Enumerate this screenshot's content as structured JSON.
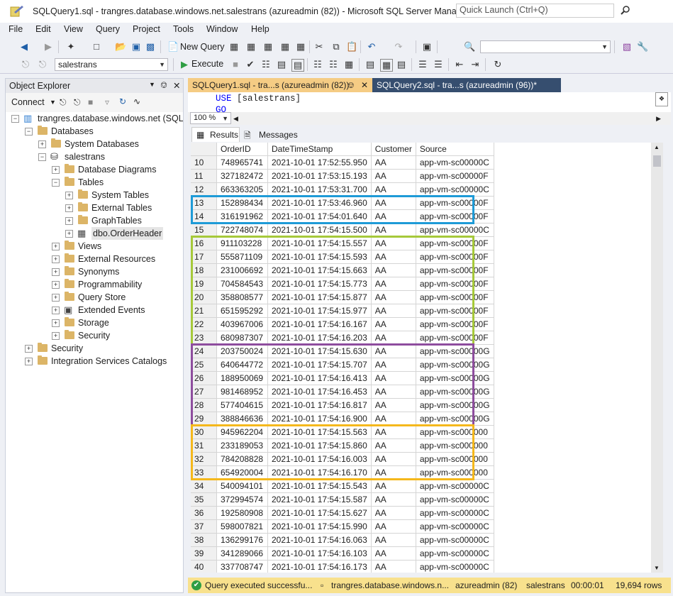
{
  "window": {
    "title": "SQLQuery1.sql - trangres.database.windows.net.salestrans (azureadmin (82)) - Microsoft SQL Server Manageme...",
    "quick_launch_placeholder": "Quick Launch (Ctrl+Q)"
  },
  "menu": [
    "File",
    "Edit",
    "View",
    "Query",
    "Project",
    "Tools",
    "Window",
    "Help"
  ],
  "toolbar": {
    "new_query_label": "New Query",
    "database_selector": "salestrans",
    "execute_label": "Execute",
    "icons": [
      "back-icon",
      "forward-icon",
      "new-project-icon",
      "open-file-icon",
      "save-icon",
      "save-all-icon",
      "cut-icon",
      "copy-icon",
      "paste-icon",
      "undo-icon",
      "redo-icon",
      "screenshot-icon",
      "find-icon",
      "properties-icon",
      "settings-icon"
    ]
  },
  "object_explorer": {
    "title": "Object Explorer",
    "connect_label": "Connect",
    "tree": [
      {
        "label": "trangres.database.windows.net (SQL Se",
        "level": 0,
        "expander": "-",
        "icon": "server-icon"
      },
      {
        "label": "Databases",
        "level": 1,
        "expander": "-",
        "icon": "folder-icon"
      },
      {
        "label": "System Databases",
        "level": 2,
        "expander": "+",
        "icon": "folder-icon"
      },
      {
        "label": "salestrans",
        "level": 2,
        "expander": "-",
        "icon": "database-icon"
      },
      {
        "label": "Database Diagrams",
        "level": 3,
        "expander": "+",
        "icon": "folder-icon"
      },
      {
        "label": "Tables",
        "level": 3,
        "expander": "-",
        "icon": "folder-icon"
      },
      {
        "label": "System Tables",
        "level": 4,
        "expander": "+",
        "icon": "folder-icon"
      },
      {
        "label": "External Tables",
        "level": 4,
        "expander": "+",
        "icon": "folder-icon"
      },
      {
        "label": "GraphTables",
        "level": 4,
        "expander": "+",
        "icon": "folder-icon"
      },
      {
        "label": "dbo.OrderHeader",
        "level": 4,
        "expander": "+",
        "icon": "table-icon"
      },
      {
        "label": "Views",
        "level": 3,
        "expander": "+",
        "icon": "folder-icon"
      },
      {
        "label": "External Resources",
        "level": 3,
        "expander": "+",
        "icon": "folder-icon"
      },
      {
        "label": "Synonyms",
        "level": 3,
        "expander": "+",
        "icon": "folder-icon"
      },
      {
        "label": "Programmability",
        "level": 3,
        "expander": "+",
        "icon": "folder-icon"
      },
      {
        "label": "Query Store",
        "level": 3,
        "expander": "+",
        "icon": "folder-icon"
      },
      {
        "label": "Extended Events",
        "level": 3,
        "expander": "+",
        "icon": "events-icon"
      },
      {
        "label": "Storage",
        "level": 3,
        "expander": "+",
        "icon": "folder-icon"
      },
      {
        "label": "Security",
        "level": 3,
        "expander": "+",
        "icon": "folder-icon"
      },
      {
        "label": "Security",
        "level": 1,
        "expander": "+",
        "icon": "folder-icon"
      },
      {
        "label": "Integration Services Catalogs",
        "level": 1,
        "expander": "+",
        "icon": "folder-icon"
      }
    ]
  },
  "tabs": {
    "active": "SQLQuery1.sql - tra...s (azureadmin (82))",
    "inactive": "SQLQuery2.sql - tra...s (azureadmin (96))*"
  },
  "editor": {
    "line1_keyword": "USE",
    "line1_rest": " [salestrans]",
    "line2": "GO"
  },
  "zoom": "100 %",
  "results_tabs": [
    "Results",
    "Messages"
  ],
  "grid": {
    "columns": [
      "OrderID",
      "DateTimeStamp",
      "Customer",
      "Source"
    ],
    "rows": [
      [
        "10",
        "748965741",
        "2021-10-01 17:52:55.950",
        "AA",
        "app-vm-sc00000C"
      ],
      [
        "11",
        "327182472",
        "2021-10-01 17:53:15.193",
        "AA",
        "app-vm-sc00000F"
      ],
      [
        "12",
        "663363205",
        "2021-10-01 17:53:31.700",
        "AA",
        "app-vm-sc00000C"
      ],
      [
        "13",
        "152898434",
        "2021-10-01 17:53:46.960",
        "AA",
        "app-vm-sc00000F"
      ],
      [
        "14",
        "316191962",
        "2021-10-01 17:54:01.640",
        "AA",
        "app-vm-sc00000F"
      ],
      [
        "15",
        "722748074",
        "2021-10-01 17:54:15.500",
        "AA",
        "app-vm-sc00000C"
      ],
      [
        "16",
        "911103228",
        "2021-10-01 17:54:15.557",
        "AA",
        "app-vm-sc00000F"
      ],
      [
        "17",
        "555871109",
        "2021-10-01 17:54:15.593",
        "AA",
        "app-vm-sc00000F"
      ],
      [
        "18",
        "231006692",
        "2021-10-01 17:54:15.663",
        "AA",
        "app-vm-sc00000F"
      ],
      [
        "19",
        "704584543",
        "2021-10-01 17:54:15.773",
        "AA",
        "app-vm-sc00000F"
      ],
      [
        "20",
        "358808577",
        "2021-10-01 17:54:15.877",
        "AA",
        "app-vm-sc00000F"
      ],
      [
        "21",
        "651595292",
        "2021-10-01 17:54:15.977",
        "AA",
        "app-vm-sc00000F"
      ],
      [
        "22",
        "403967006",
        "2021-10-01 17:54:16.167",
        "AA",
        "app-vm-sc00000F"
      ],
      [
        "23",
        "680987307",
        "2021-10-01 17:54:16.203",
        "AA",
        "app-vm-sc00000F"
      ],
      [
        "24",
        "203750024",
        "2021-10-01 17:54:15.630",
        "AA",
        "app-vm-sc00000G"
      ],
      [
        "25",
        "640644772",
        "2021-10-01 17:54:15.707",
        "AA",
        "app-vm-sc00000G"
      ],
      [
        "26",
        "188950069",
        "2021-10-01 17:54:16.413",
        "AA",
        "app-vm-sc00000G"
      ],
      [
        "27",
        "981468952",
        "2021-10-01 17:54:16.453",
        "AA",
        "app-vm-sc00000G"
      ],
      [
        "28",
        "577404615",
        "2021-10-01 17:54:16.817",
        "AA",
        "app-vm-sc00000G"
      ],
      [
        "29",
        "388846636",
        "2021-10-01 17:54:16.900",
        "AA",
        "app-vm-sc00000G"
      ],
      [
        "30",
        "945962204",
        "2021-10-01 17:54:15.563",
        "AA",
        "app-vm-sc000000"
      ],
      [
        "31",
        "233189053",
        "2021-10-01 17:54:15.860",
        "AA",
        "app-vm-sc000000"
      ],
      [
        "32",
        "784208828",
        "2021-10-01 17:54:16.003",
        "AA",
        "app-vm-sc000000"
      ],
      [
        "33",
        "654920004",
        "2021-10-01 17:54:16.170",
        "AA",
        "app-vm-sc000000"
      ],
      [
        "34",
        "540094101",
        "2021-10-01 17:54:15.543",
        "AA",
        "app-vm-sc00000C"
      ],
      [
        "35",
        "372994574",
        "2021-10-01 17:54:15.587",
        "AA",
        "app-vm-sc00000C"
      ],
      [
        "36",
        "192580908",
        "2021-10-01 17:54:15.627",
        "AA",
        "app-vm-sc00000C"
      ],
      [
        "37",
        "598007821",
        "2021-10-01 17:54:15.990",
        "AA",
        "app-vm-sc00000C"
      ],
      [
        "38",
        "136299176",
        "2021-10-01 17:54:16.063",
        "AA",
        "app-vm-sc00000C"
      ],
      [
        "39",
        "341289066",
        "2021-10-01 17:54:16.103",
        "AA",
        "app-vm-sc00000C"
      ],
      [
        "40",
        "337708747",
        "2021-10-01 17:54:16.173",
        "AA",
        "app-vm-sc00000C"
      ]
    ],
    "highlight_groups": [
      {
        "first_row": "13",
        "last_row": "14",
        "color": "#1e9bd7"
      },
      {
        "first_row": "16",
        "last_row": "23",
        "color": "#a6c93a"
      },
      {
        "first_row": "24",
        "last_row": "29",
        "color": "#8e4d9e"
      },
      {
        "first_row": "30",
        "last_row": "33",
        "color": "#f5b81c"
      }
    ]
  },
  "status": {
    "message": "Query executed successfu...",
    "server": "trangres.database.windows.n...",
    "user": "azureadmin (82)",
    "database": "salestrans",
    "elapsed": "00:00:01",
    "rows": "19,694 rows"
  },
  "colors": {
    "active_tab": "#f5cc84",
    "inactive_tab": "#364e6f",
    "status_bar": "#f8e18d",
    "keyword": "#0000ff"
  }
}
